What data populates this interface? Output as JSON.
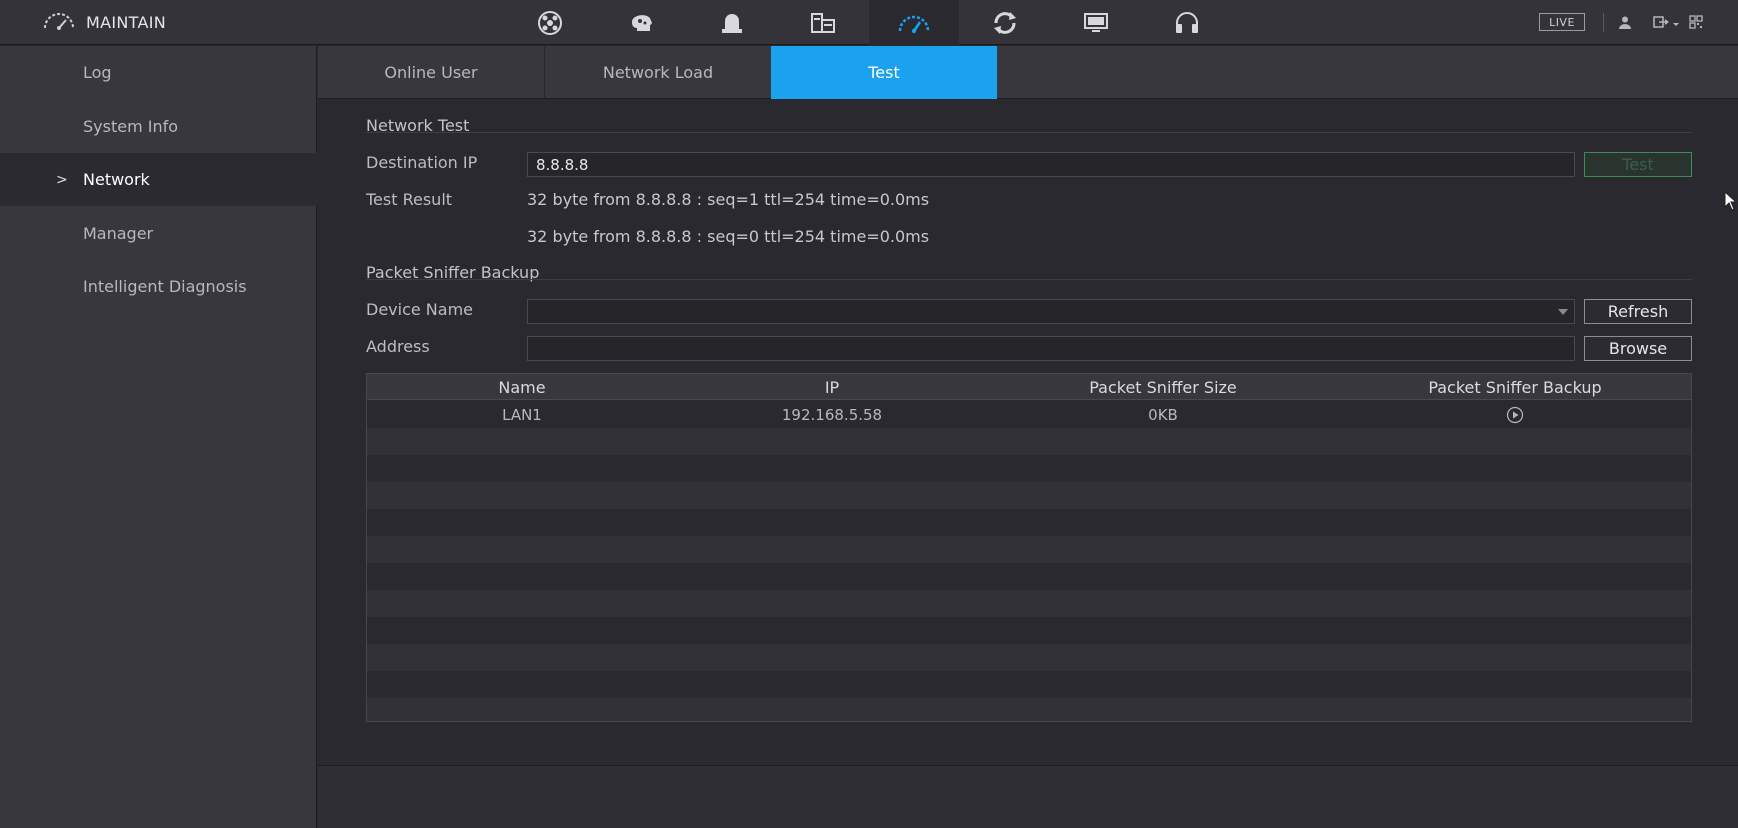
{
  "header": {
    "title": "MAINTAIN",
    "live_label": "LIVE",
    "nav_icons": [
      "playback-icon",
      "ai-icon",
      "alarm-icon",
      "storage-icon",
      "maintain-icon",
      "backup-icon",
      "display-icon",
      "audio-icon"
    ]
  },
  "sidebar": {
    "items": [
      {
        "label": "Log"
      },
      {
        "label": "System Info"
      },
      {
        "label": "Network",
        "chevron": ">"
      },
      {
        "label": "Manager"
      },
      {
        "label": "Intelligent Diagnosis"
      }
    ]
  },
  "tabs": [
    {
      "label": "Online User"
    },
    {
      "label": "Network Load"
    },
    {
      "label": "Test"
    }
  ],
  "network_test": {
    "section_title": "Network Test",
    "destination_label": "Destination IP",
    "destination_value": "8.8.8.8",
    "test_button": "Test",
    "result_label": "Test Result",
    "results": [
      "32 byte from 8.8.8.8 : seq=1 ttl=254 time=0.0ms",
      "32 byte from 8.8.8.8 : seq=0 ttl=254 time=0.0ms"
    ]
  },
  "sniffer": {
    "section_title": "Packet Sniffer Backup",
    "device_name_label": "Device Name",
    "device_name_value": "",
    "refresh_button": "Refresh",
    "address_label": "Address",
    "address_value": "",
    "browse_button": "Browse",
    "columns": [
      "Name",
      "IP",
      "Packet Sniffer Size",
      "Packet Sniffer Backup"
    ],
    "rows": [
      {
        "name": "LAN1",
        "ip": "192.168.5.58",
        "size": "0KB"
      }
    ]
  },
  "colors": {
    "accent": "#1aa2ef",
    "background": "#2a2930",
    "panel": "#38373d"
  }
}
